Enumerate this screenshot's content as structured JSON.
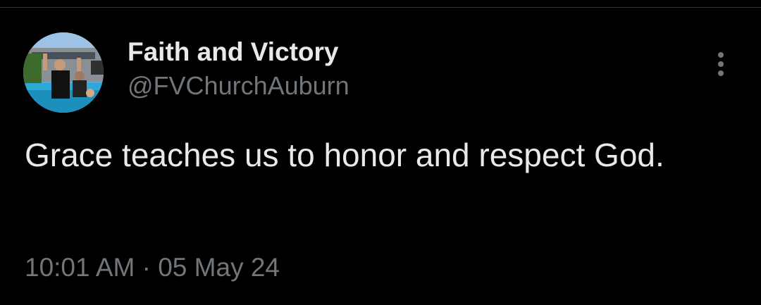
{
  "tweet": {
    "author": {
      "display_name": "Faith and Victory",
      "handle": "@FVChurchAuburn",
      "avatar": "profile-photo"
    },
    "text": "Grace teaches us to honor and respect God.",
    "time": "10:01 AM",
    "separator": "·",
    "date": "05 May 24",
    "more_icon": "more-vertical-icon"
  },
  "colors": {
    "background": "#000000",
    "primary_text": "#e7e9ea",
    "secondary_text": "#71767b",
    "divider": "#2f3336"
  }
}
